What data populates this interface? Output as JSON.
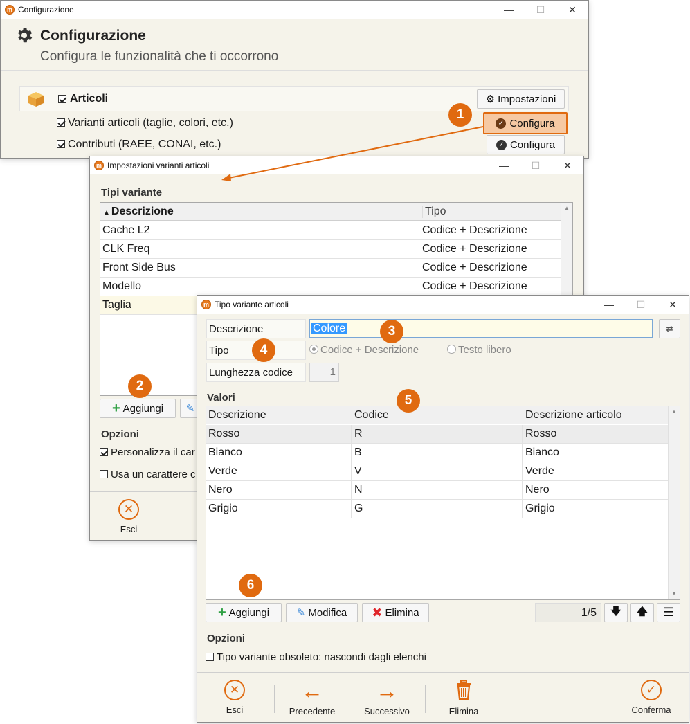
{
  "main_window": {
    "title": "Configurazione",
    "heading": "Configurazione",
    "subheading": "Configura le funzionalità che ti occorrono",
    "section": {
      "label": "Articoli",
      "checked": true,
      "settings_button": "Impostazioni"
    },
    "features": [
      {
        "label": "Varianti articoli (taglie, colori, etc.)",
        "checked": true,
        "button": "Configura"
      },
      {
        "label": "Contributi (RAEE, CONAI, etc.)",
        "checked": true,
        "button": "Configura"
      }
    ]
  },
  "variants_window": {
    "title": "Impostazioni varianti articoli",
    "section_label": "Tipi variante",
    "columns": [
      "Descrizione",
      "Tipo"
    ],
    "rows": [
      {
        "descrizione": "Cache L2",
        "tipo": "Codice + Descrizione"
      },
      {
        "descrizione": "CLK Freq",
        "tipo": "Codice + Descrizione"
      },
      {
        "descrizione": "Front Side Bus",
        "tipo": "Codice + Descrizione"
      },
      {
        "descrizione": "Modello",
        "tipo": "Codice + Descrizione"
      },
      {
        "descrizione": "Taglia",
        "tipo": ""
      }
    ],
    "add_button": "Aggiungi",
    "options_label": "Opzioni",
    "option_1": "Personalizza il car",
    "option_2": "Usa un carattere c",
    "exit_label": "Esci"
  },
  "type_window": {
    "title": "Tipo variante articoli",
    "fields": {
      "descrizione_label": "Descrizione",
      "descrizione_value": "Colore",
      "tipo_label": "Tipo",
      "tipo_option_1": "Codice + Descrizione",
      "tipo_option_2": "Testo libero",
      "lunghezza_label": "Lunghezza codice",
      "lunghezza_value": "1"
    },
    "values_label": "Valori",
    "columns": [
      "Descrizione",
      "Codice",
      "Descrizione articolo"
    ],
    "rows": [
      {
        "descrizione": "Rosso",
        "codice": "R",
        "articolo": "Rosso"
      },
      {
        "descrizione": "Bianco",
        "codice": "B",
        "articolo": "Bianco"
      },
      {
        "descrizione": "Verde",
        "codice": "V",
        "articolo": "Verde"
      },
      {
        "descrizione": "Nero",
        "codice": "N",
        "articolo": "Nero"
      },
      {
        "descrizione": "Grigio",
        "codice": "G",
        "articolo": "Grigio"
      }
    ],
    "buttons": {
      "add": "Aggiungi",
      "edit": "Modifica",
      "delete": "Elimina"
    },
    "pager": "1/5",
    "options_label": "Opzioni",
    "option_obsolete": "Tipo variante obsoleto: nascondi dagli elenchi",
    "toolbar": {
      "exit": "Esci",
      "prev": "Precedente",
      "next": "Successivo",
      "delete": "Elimina",
      "confirm": "Conferma"
    }
  },
  "badges": [
    "1",
    "2",
    "3",
    "4",
    "5",
    "6"
  ],
  "colors": {
    "accent": "#e06a10",
    "selection": "#3399ff",
    "highlight_row": "#fcf9e6"
  }
}
